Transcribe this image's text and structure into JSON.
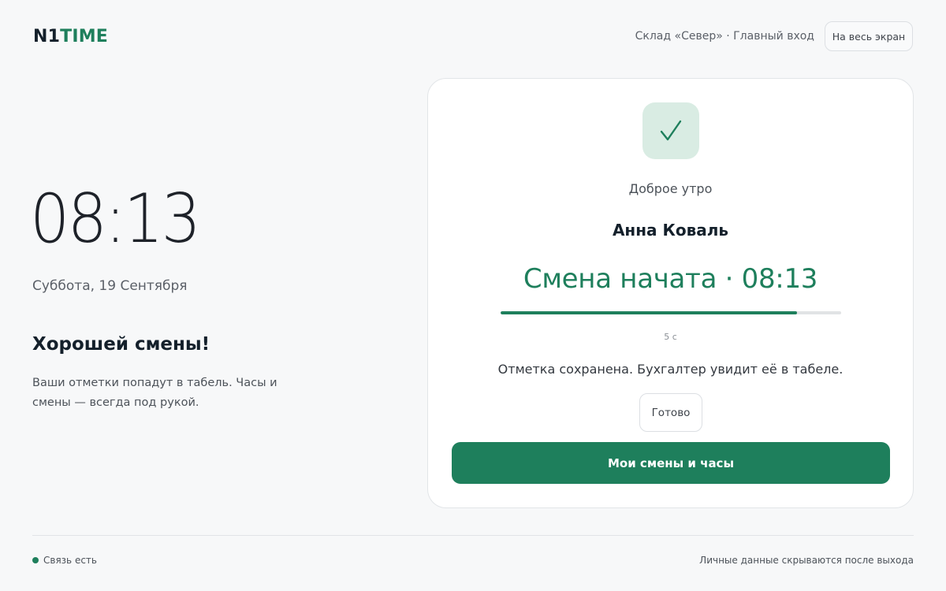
{
  "header": {
    "logo_n1": "N1",
    "logo_time": "TIME",
    "location": "Склад «Север» · Главный вход",
    "fullscreen_label": "На весь экран"
  },
  "left": {
    "clock": "08:13",
    "date": "Суббота, 19 Сентября",
    "greeting": "Хорошей смены!",
    "tagline": "Ваши отметки попадут в табель. Часы и смены — всегда под рукой."
  },
  "card": {
    "icon": "check-icon",
    "salute": "Доброе утро",
    "employee_name": "Анна Коваль",
    "shift_status": "Смена начата · 08:13",
    "progress_fraction": 0.87,
    "countdown": "5 с",
    "saved_note": "Отметка сохранена. Бухгалтер увидит её в табеле.",
    "done_label": "Готово",
    "primary_label": "Мои смены и часы"
  },
  "footer": {
    "connection_status": "Связь есть",
    "privacy_note": "Личные данные скрываются после выхода"
  },
  "colors": {
    "accent": "#1e7f5c",
    "accent_soft": "#d9ece3",
    "background": "#f7f8f9"
  }
}
